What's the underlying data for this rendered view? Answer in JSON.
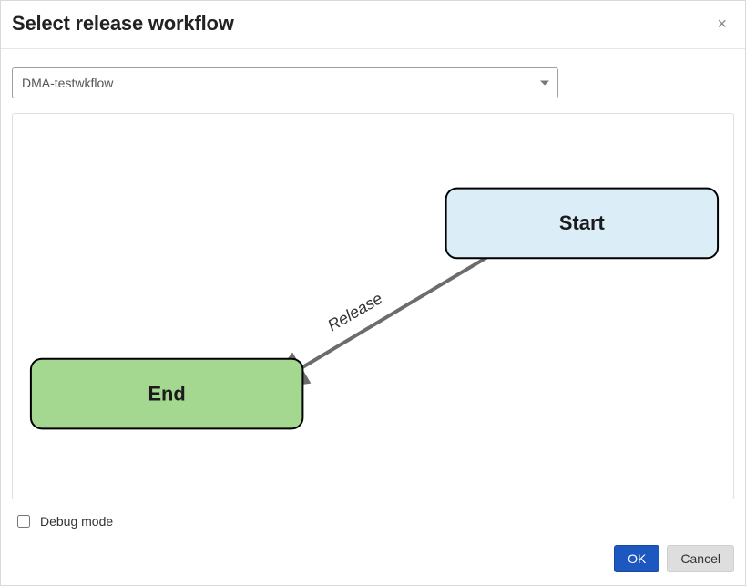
{
  "dialog": {
    "title": "Select release workflow",
    "close_label": "×"
  },
  "workflow_select": {
    "selected": "DMA-testwkflow"
  },
  "diagram": {
    "nodes": {
      "start": {
        "label": "Start"
      },
      "end": {
        "label": "End"
      }
    },
    "edge": {
      "label": "Release"
    }
  },
  "debug": {
    "label": "Debug mode",
    "checked": false
  },
  "buttons": {
    "ok": "OK",
    "cancel": "Cancel"
  }
}
